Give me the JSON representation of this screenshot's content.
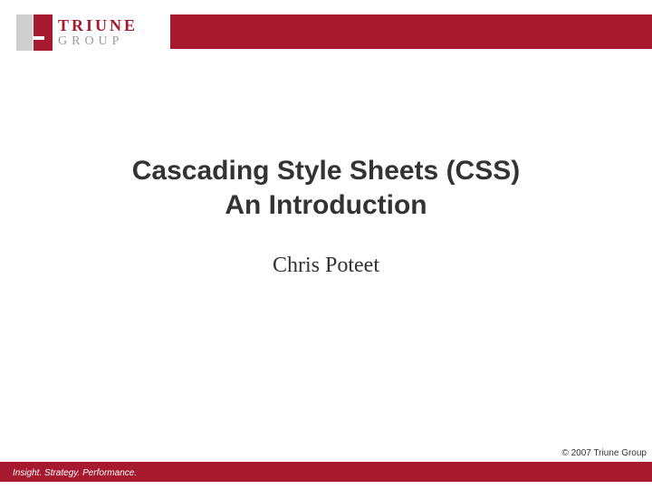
{
  "logo": {
    "line1": "TRIUNE",
    "line2": "GROUP"
  },
  "title": {
    "line1": "Cascading Style Sheets (CSS)",
    "line2": "An Introduction"
  },
  "author": "Chris Poteet",
  "copyright": "© 2007 Triune Group",
  "tagline": "Insight. Strategy. Performance."
}
